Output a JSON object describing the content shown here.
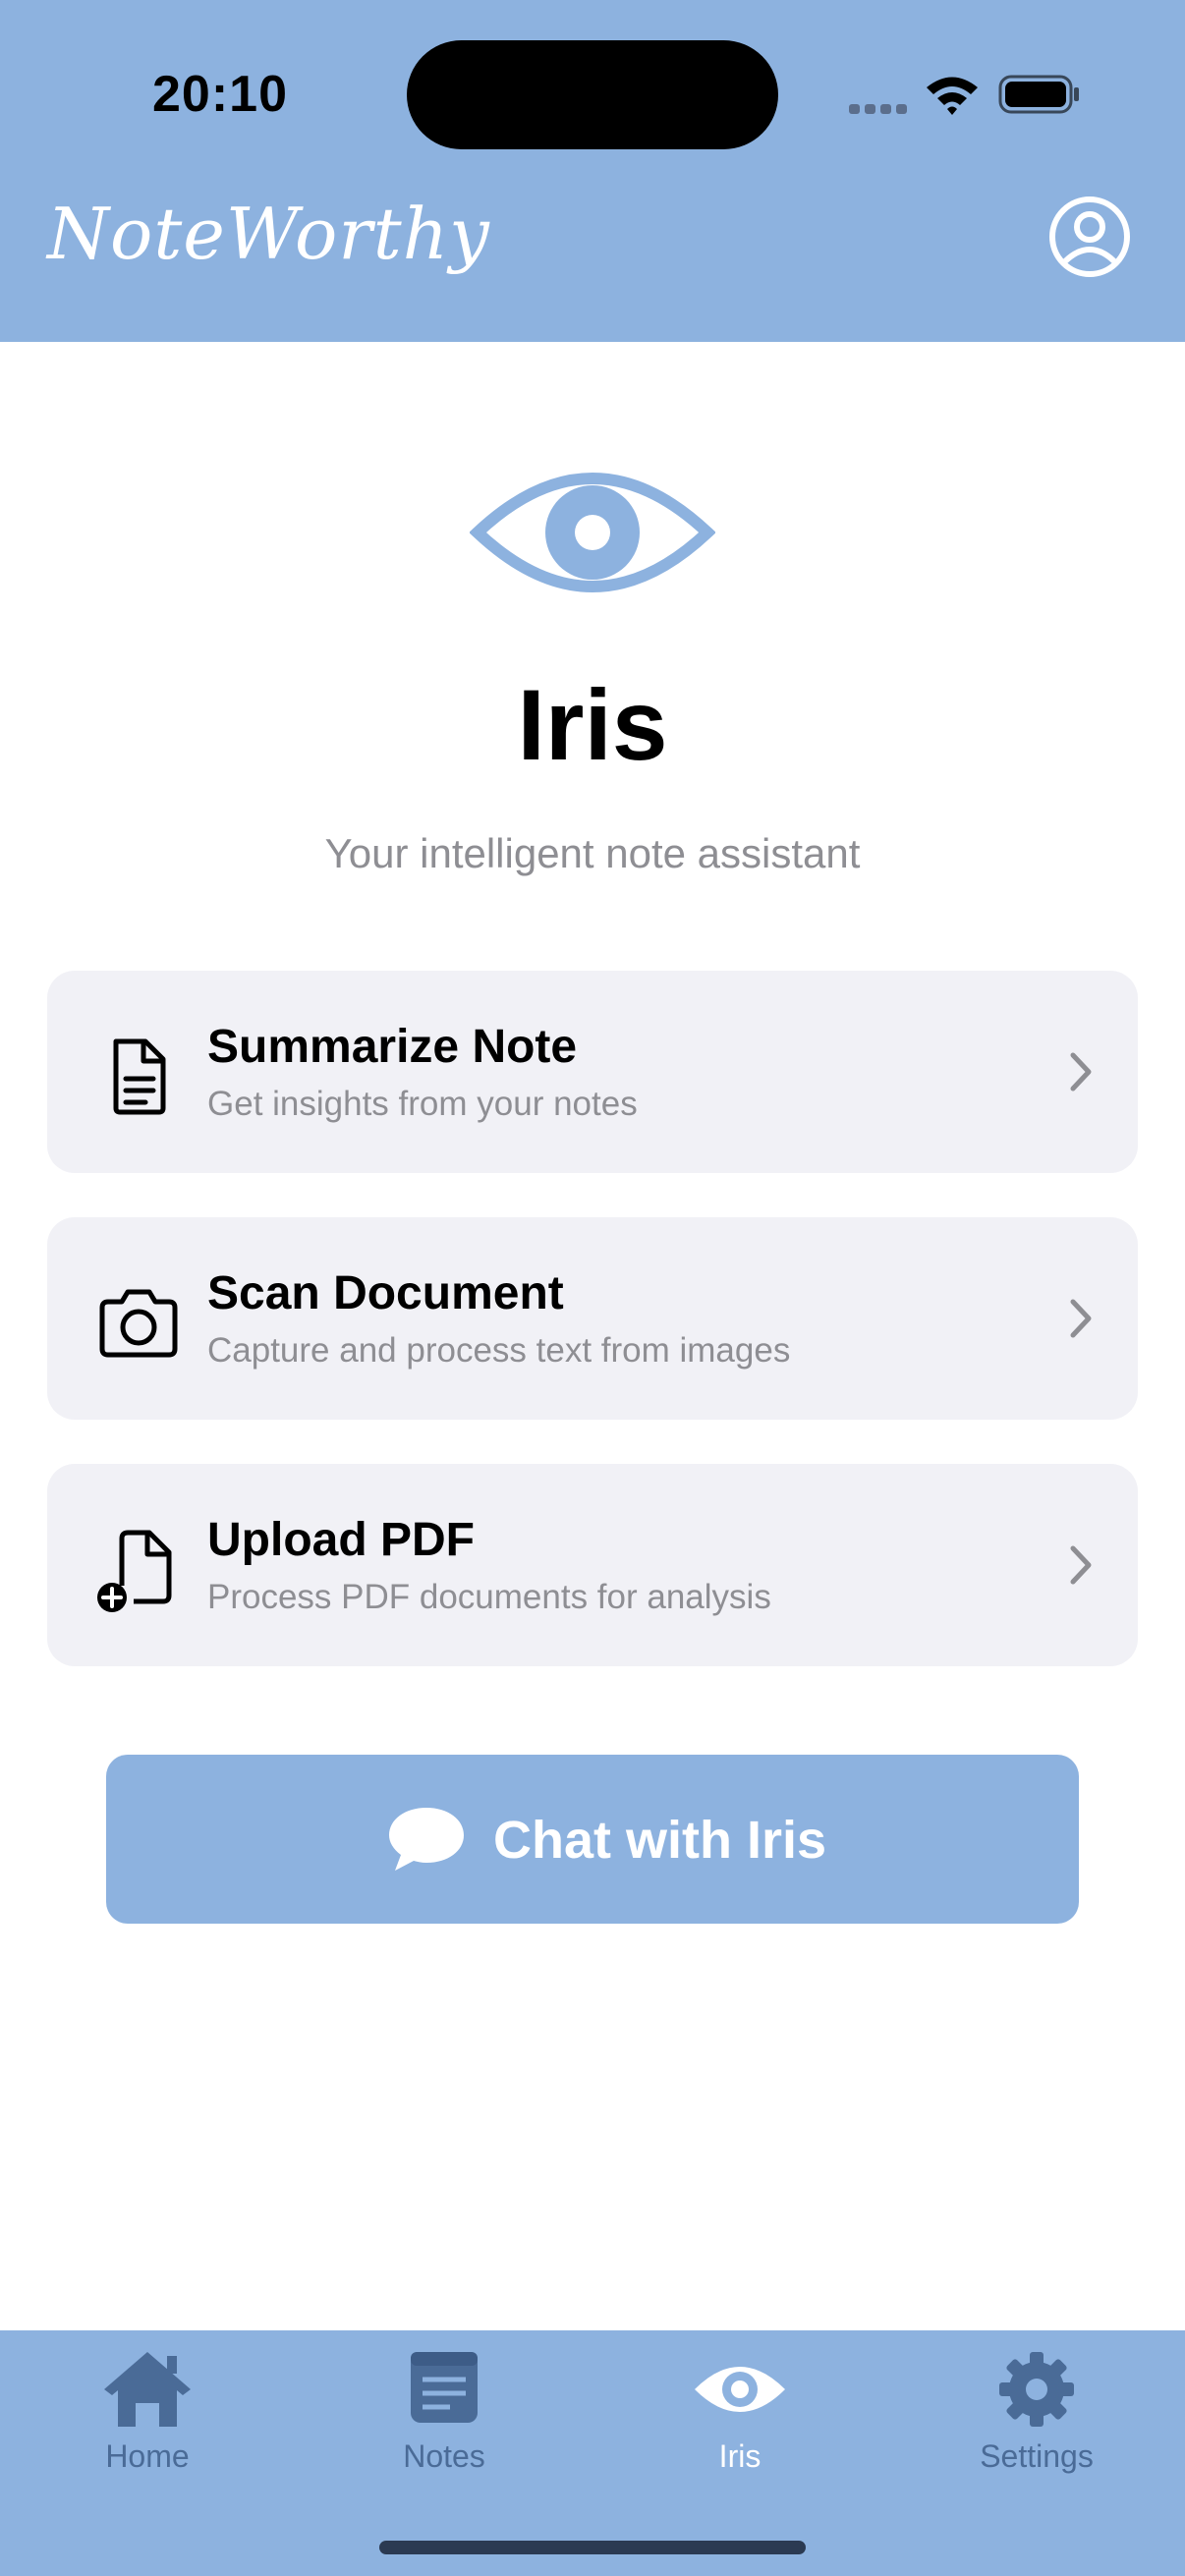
{
  "status_bar": {
    "time": "20:10",
    "signal_icon": "cellular-signal-icon",
    "wifi_icon": "wifi-icon",
    "battery_icon": "battery-icon"
  },
  "header": {
    "title": "NoteWorthy",
    "profile_icon": "person-circle-icon"
  },
  "hero": {
    "icon": "eye-icon",
    "title": "Iris",
    "subtitle": "Your intelligent note assistant"
  },
  "actions": [
    {
      "icon": "document-text-icon",
      "title": "Summarize Note",
      "description": "Get insights from your notes"
    },
    {
      "icon": "camera-icon",
      "title": "Scan Document",
      "description": "Capture and process text from images"
    },
    {
      "icon": "document-add-icon",
      "title": "Upload PDF",
      "description": "Process PDF documents for analysis"
    }
  ],
  "chat_button": {
    "icon": "chat-bubble-icon",
    "label": "Chat with Iris"
  },
  "tabbar": {
    "tabs": [
      {
        "label": "Home",
        "icon": "house-icon",
        "active": false
      },
      {
        "label": "Notes",
        "icon": "notes-icon",
        "active": false
      },
      {
        "label": "Iris",
        "icon": "eye-icon",
        "active": true
      },
      {
        "label": "Settings",
        "icon": "gear-icon",
        "active": false
      }
    ]
  },
  "colors": {
    "brand": "#8db2df",
    "card_background": "#f1f1f6",
    "secondary_text": "#8e8e93",
    "tab_inactive": "#4a6b97",
    "tab_active": "#ffffff"
  }
}
